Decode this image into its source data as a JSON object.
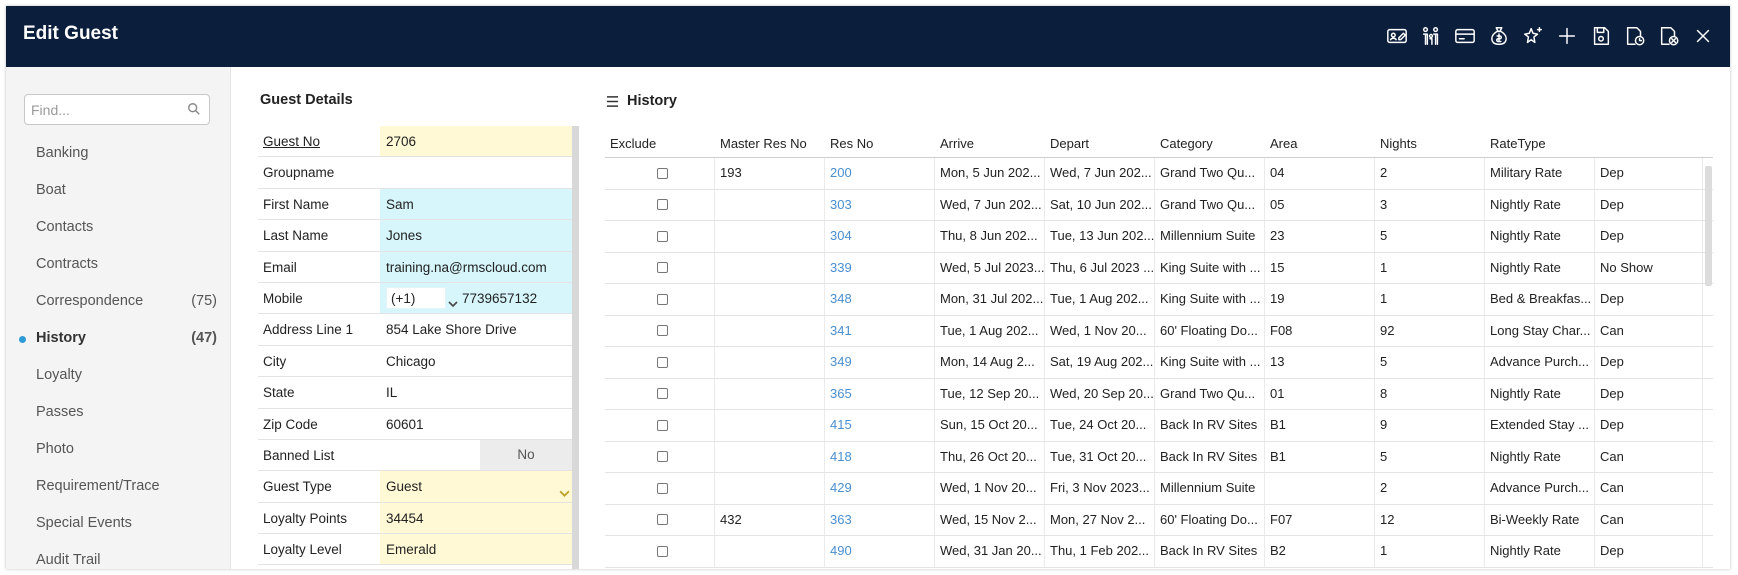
{
  "window": {
    "title": "Edit Guest"
  },
  "toolbar_icons": [
    "id-card-edit-icon",
    "family-icon",
    "card-icon",
    "money-bag-icon",
    "stars-icon",
    "plus-icon",
    "save-icon",
    "save-calendar-icon",
    "save-close-icon",
    "close-icon"
  ],
  "sidebar": {
    "search_placeholder": "Find...",
    "items": [
      {
        "label": "Banking",
        "count": ""
      },
      {
        "label": "Boat",
        "count": ""
      },
      {
        "label": "Contacts",
        "count": ""
      },
      {
        "label": "Contracts",
        "count": ""
      },
      {
        "label": "Correspondence",
        "count": "(75)"
      },
      {
        "label": "History",
        "count": "(47)",
        "active": true
      },
      {
        "label": "Loyalty",
        "count": ""
      },
      {
        "label": "Passes",
        "count": ""
      },
      {
        "label": "Photo",
        "count": ""
      },
      {
        "label": "Requirement/Trace",
        "count": ""
      },
      {
        "label": "Special Events",
        "count": ""
      },
      {
        "label": "Audit Trail",
        "count": ""
      }
    ]
  },
  "guest_details": {
    "title": "Guest Details",
    "guest_no_label": "Guest No",
    "guest_no": "2706",
    "groupname_label": "Groupname",
    "groupname": "",
    "first_name_label": "First Name",
    "first_name": "Sam",
    "last_name_label": "Last Name",
    "last_name": "Jones",
    "email_label": "Email",
    "email": "training.na@rmscloud.com",
    "mobile_label": "Mobile",
    "mobile_prefix": "(+1)",
    "mobile": "7739657132",
    "address_label": "Address Line 1",
    "address": "854 Lake Shore Drive",
    "city_label": "City",
    "city": "Chicago",
    "state_label": "State",
    "state": "IL",
    "zip_label": "Zip Code",
    "zip": "60601",
    "banned_label": "Banned List",
    "banned": "No",
    "guest_type_label": "Guest Type",
    "guest_type": "Guest",
    "loyalty_points_label": "Loyalty Points",
    "loyalty_points": "34454",
    "loyalty_level_label": "Loyalty Level",
    "loyalty_level": "Emerald"
  },
  "history": {
    "title": "History",
    "columns": [
      "Exclude",
      "Master Res No",
      "Res No",
      "Arrive",
      "Depart",
      "Category",
      "Area",
      "Nights",
      "RateType",
      ""
    ],
    "rows": [
      {
        "master": "193",
        "res": "200",
        "arrive": "Mon, 5 Jun 202...",
        "depart": "Wed, 7 Jun 202...",
        "category": "Grand Two Qu...",
        "area": "04",
        "nights": "2",
        "rate": "Military Rate",
        "status": "Dep"
      },
      {
        "master": "",
        "res": "303",
        "arrive": "Wed, 7 Jun 202...",
        "depart": "Sat, 10 Jun 202...",
        "category": "Grand Two Qu...",
        "area": "05",
        "nights": "3",
        "rate": "Nightly Rate",
        "status": "Dep"
      },
      {
        "master": "",
        "res": "304",
        "arrive": "Thu, 8 Jun 202...",
        "depart": "Tue, 13 Jun 202...",
        "category": "Millennium Suite",
        "area": "23",
        "nights": "5",
        "rate": "Nightly Rate",
        "status": "Dep"
      },
      {
        "master": "",
        "res": "339",
        "arrive": "Wed, 5 Jul 2023...",
        "depart": "Thu, 6 Jul 2023 ...",
        "category": "King Suite with ...",
        "area": "15",
        "nights": "1",
        "rate": "Nightly Rate",
        "status": "No Show"
      },
      {
        "master": "",
        "res": "348",
        "arrive": "Mon, 31 Jul 202...",
        "depart": "Tue, 1 Aug 202...",
        "category": "King Suite with ...",
        "area": "19",
        "nights": "1",
        "rate": "Bed & Breakfas...",
        "status": "Dep"
      },
      {
        "master": "",
        "res": "341",
        "arrive": "Tue, 1 Aug 202...",
        "depart": "Wed, 1 Nov 20...",
        "category": "60' Floating Do...",
        "area": "F08",
        "nights": "92",
        "rate": "Long Stay Char...",
        "status": "Can"
      },
      {
        "master": "",
        "res": "349",
        "arrive": "Mon, 14 Aug 2...",
        "depart": "Sat, 19 Aug 202...",
        "category": "King Suite with ...",
        "area": "13",
        "nights": "5",
        "rate": "Advance Purch...",
        "status": "Dep"
      },
      {
        "master": "",
        "res": "365",
        "arrive": "Tue, 12 Sep 20...",
        "depart": "Wed, 20 Sep 20...",
        "category": "Grand Two Qu...",
        "area": "01",
        "nights": "8",
        "rate": "Nightly Rate",
        "status": "Dep"
      },
      {
        "master": "",
        "res": "415",
        "arrive": "Sun, 15 Oct 20...",
        "depart": "Tue, 24 Oct 20...",
        "category": "Back In RV Sites",
        "area": "B1",
        "nights": "9",
        "rate": "Extended Stay ...",
        "status": "Dep"
      },
      {
        "master": "",
        "res": "418",
        "arrive": "Thu, 26 Oct 20...",
        "depart": "Tue, 31 Oct 20...",
        "category": "Back In RV Sites",
        "area": "B1",
        "nights": "5",
        "rate": "Nightly Rate",
        "status": "Can"
      },
      {
        "master": "",
        "res": "429",
        "arrive": "Wed, 1 Nov 20...",
        "depart": "Fri, 3 Nov 2023...",
        "category": "Millennium Suite",
        "area": "",
        "nights": "2",
        "rate": "Advance Purch...",
        "status": "Can"
      },
      {
        "master": "432",
        "res": "363",
        "arrive": "Wed, 15 Nov 2...",
        "depart": "Mon, 27 Nov 2...",
        "category": "60' Floating Do...",
        "area": "F07",
        "nights": "12",
        "rate": "Bi-Weekly Rate",
        "status": "Can"
      },
      {
        "master": "",
        "res": "490",
        "arrive": "Wed, 31 Jan 20...",
        "depart": "Thu, 1 Feb 202...",
        "category": "Back In RV Sites",
        "area": "B2",
        "nights": "1",
        "rate": "Nightly Rate",
        "status": "Dep"
      }
    ]
  }
}
